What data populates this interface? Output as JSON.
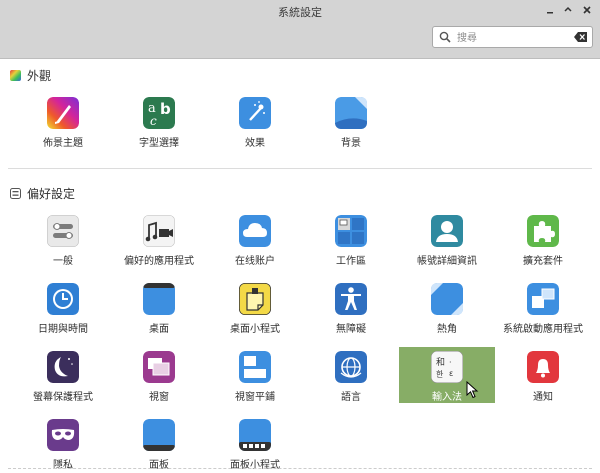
{
  "window": {
    "title": "系統設定",
    "buttons": [
      "minimize",
      "restore",
      "close"
    ]
  },
  "search": {
    "placeholder": "搜尋",
    "value": ""
  },
  "sections": [
    {
      "title": "外觀",
      "items": [
        {
          "label": "佈景主題",
          "icon": "themes-icon"
        },
        {
          "label": "字型選擇",
          "icon": "fonts-icon"
        },
        {
          "label": "效果",
          "icon": "effects-icon"
        },
        {
          "label": "背景",
          "icon": "backgrounds-icon"
        }
      ]
    },
    {
      "title": "偏好設定",
      "items": [
        {
          "label": "一般",
          "icon": "general-icon"
        },
        {
          "label": "偏好的應用程式",
          "icon": "preferred-apps-icon"
        },
        {
          "label": "在线账户",
          "icon": "online-accounts-icon"
        },
        {
          "label": "工作區",
          "icon": "workspaces-icon"
        },
        {
          "label": "帳號詳細資訊",
          "icon": "account-details-icon"
        },
        {
          "label": "擴充套件",
          "icon": "extensions-icon"
        },
        {
          "label": "日期與時間",
          "icon": "date-time-icon"
        },
        {
          "label": "桌面",
          "icon": "desktop-icon"
        },
        {
          "label": "桌面小程式",
          "icon": "desklets-icon"
        },
        {
          "label": "無障礙",
          "icon": "accessibility-icon"
        },
        {
          "label": "熱角",
          "icon": "hot-corners-icon"
        },
        {
          "label": "系統啟動應用程式",
          "icon": "startup-apps-icon"
        },
        {
          "label": "螢幕保護程式",
          "icon": "screensaver-icon"
        },
        {
          "label": "視窗",
          "icon": "windows-icon"
        },
        {
          "label": "視窗平鋪",
          "icon": "window-tiling-icon"
        },
        {
          "label": "語言",
          "icon": "languages-icon"
        },
        {
          "label": "輸入法",
          "icon": "input-method-icon",
          "selected": true
        },
        {
          "label": "通知",
          "icon": "notifications-icon"
        },
        {
          "label": "隱私",
          "icon": "privacy-icon"
        },
        {
          "label": "面板",
          "icon": "panel-icon"
        },
        {
          "label": "面板小程式",
          "icon": "applets-icon"
        }
      ]
    }
  ],
  "colors": {
    "titlebar": "#d4d4d4",
    "selection": "#87ad66"
  }
}
